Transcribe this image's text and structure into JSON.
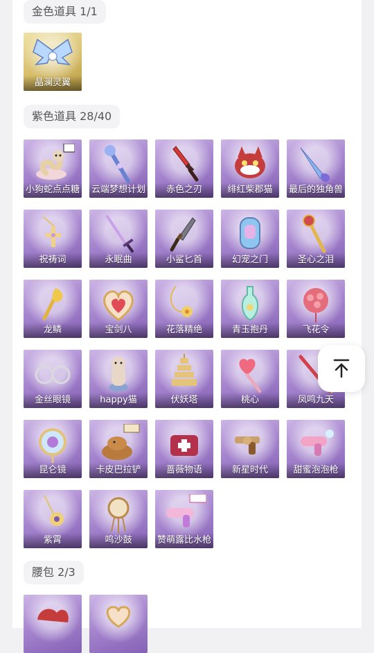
{
  "sections": {
    "gold": {
      "label": "金色道具 1/1",
      "items": [
        {
          "label": "晶澜灵翼",
          "icon": "crystal-wings-icon"
        }
      ]
    },
    "purple": {
      "label": "紫色道具 28/40",
      "items": [
        {
          "label": "小狗蛇点点糖",
          "icon": "snake-pet-icon"
        },
        {
          "label": "云端梦想计划",
          "icon": "magic-wand-icon"
        },
        {
          "label": "赤色之刃",
          "icon": "red-dagger-icon"
        },
        {
          "label": "绯红柴郡猫",
          "icon": "red-cat-icon"
        },
        {
          "label": "最后的独角兽",
          "icon": "unicorn-horn-icon"
        },
        {
          "label": "祝祷词",
          "icon": "cross-necklace-icon"
        },
        {
          "label": "永眠曲",
          "icon": "sword-icon"
        },
        {
          "label": "小鲨匕首",
          "icon": "shark-dagger-icon"
        },
        {
          "label": "幻宠之门",
          "icon": "gate-phone-icon"
        },
        {
          "label": "圣心之泪",
          "icon": "scepter-icon"
        },
        {
          "label": "龙鳞",
          "icon": "golden-spade-icon"
        },
        {
          "label": "宝剑八",
          "icon": "heart-frame-icon"
        },
        {
          "label": "花落精绝",
          "icon": "flower-pendant-icon"
        },
        {
          "label": "青玉抱丹",
          "icon": "jade-bottle-icon"
        },
        {
          "label": "飞花令",
          "icon": "flower-lantern-icon"
        },
        {
          "label": "金丝眼镜",
          "icon": "glasses-icon"
        },
        {
          "label": "happy猫",
          "icon": "happy-cat-icon"
        },
        {
          "label": "伏妖塔",
          "icon": "pagoda-icon"
        },
        {
          "label": "桃心",
          "icon": "heart-wand-icon"
        },
        {
          "label": "凤鸣九天",
          "icon": "phoenix-staff-icon"
        },
        {
          "label": "昆仑镜",
          "icon": "mirror-icon"
        },
        {
          "label": "卡皮巴拉铲",
          "icon": "capybara-shovel-icon"
        },
        {
          "label": "蔷薇物语",
          "icon": "medical-kit-icon"
        },
        {
          "label": "新星时代",
          "icon": "revolver-icon"
        },
        {
          "label": "甜蜜泡泡枪",
          "icon": "bubble-gun-icon"
        },
        {
          "label": "紫霄",
          "icon": "bell-pendant-icon"
        },
        {
          "label": "鸣沙鼓",
          "icon": "drum-charm-icon"
        },
        {
          "label": "赞萌露比水枪",
          "icon": "water-gun-icon"
        }
      ]
    },
    "waist": {
      "label": "腰包 2/3",
      "items": [
        {
          "label": "",
          "icon": "red-bag-icon"
        },
        {
          "label": "",
          "icon": "heart-bag-icon"
        }
      ]
    }
  },
  "colors": {
    "purple_card": "#a786cf",
    "gold_card": "#d7be6a",
    "chip_bg": "#f3f3f5"
  },
  "back_to_top_icon": "arrow-up-to-line-icon"
}
